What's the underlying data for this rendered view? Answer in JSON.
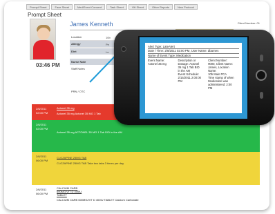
{
  "tabs": [
    "Prompt Sheet",
    "Face Sheet",
    "Med/Event Consent",
    "Task Sheet",
    "Vitl Sheet",
    "Other Reports",
    "New Protocol"
  ],
  "title": "Prompt Sheet",
  "patient": {
    "name": "James Kenneth",
    "time": "03:46 PM",
    "client_number": "Client Number: 01"
  },
  "status": "Pharmacy waiting to be received",
  "fields": [
    {
      "label": "Location",
      "value": "10b"
    },
    {
      "label": "Allergy",
      "value": "Pe"
    },
    {
      "label": "Diet",
      "value": "Lo"
    },
    {
      "label": "Nurse Note",
      "value": ""
    },
    {
      "label": "Staff Notes",
      "value": ""
    },
    {
      "label": "PRN / OTC",
      "value": ""
    }
  ],
  "bands": [
    {
      "date": "2/6/2011\n02:00 PM",
      "lines": [
        "Actonel 35 mg",
        "Actonel 35 mg Actonel 35 MG 1 Tab"
      ]
    },
    {
      "date": "2/6/2011\n02:00 PM",
      "lines": [
        "Actonel 35 mg ACTONEL 35 MG 1 Tab DID in the AM"
      ]
    },
    {
      "date": "2/6/2011\n06:00 PM",
      "lines": [
        "CLOZAPINE 25MG TAB",
        "CLOZAPINE 25MG TAB Take two tabs 3 times per day"
      ]
    },
    {
      "date": "2/6/2011\n06:00 PM",
      "lines": [
        "CALCIUM CARB",
        "600MG/VIT D 400IU",
        "TABLET",
        "CALCIUM CARB 600MG/VIT D 400IU TABLET Calcium Carbonate"
      ]
    }
  ],
  "alert": {
    "type": "Alert Type: LateAlert",
    "date": "Date / Time: 2/8/2011 02:00 PM, User Name: dbarnes",
    "event_name": "Name of Event Type: Medication",
    "col1": [
      "Event Name:",
      "Actonel 35 mg"
    ],
    "col2": [
      "Description or Dosage: Actonel",
      "35 mg 1 Tab BID",
      "in the AM",
      "Event Schedule:",
      "2/15/2011 2:00:00",
      "PM"
    ],
    "col3": [
      "Client Number:",
      "9000, Client Name:",
      "James, Location Name:",
      "10b Main PCA",
      "Time stamp of when",
      "Medication was",
      "administered: 2:00",
      "PM"
    ]
  },
  "colors": {
    "red": "#e53a2c",
    "green": "#26b84a",
    "yellow": "#f0d53b",
    "accent": "#2d97d3"
  }
}
